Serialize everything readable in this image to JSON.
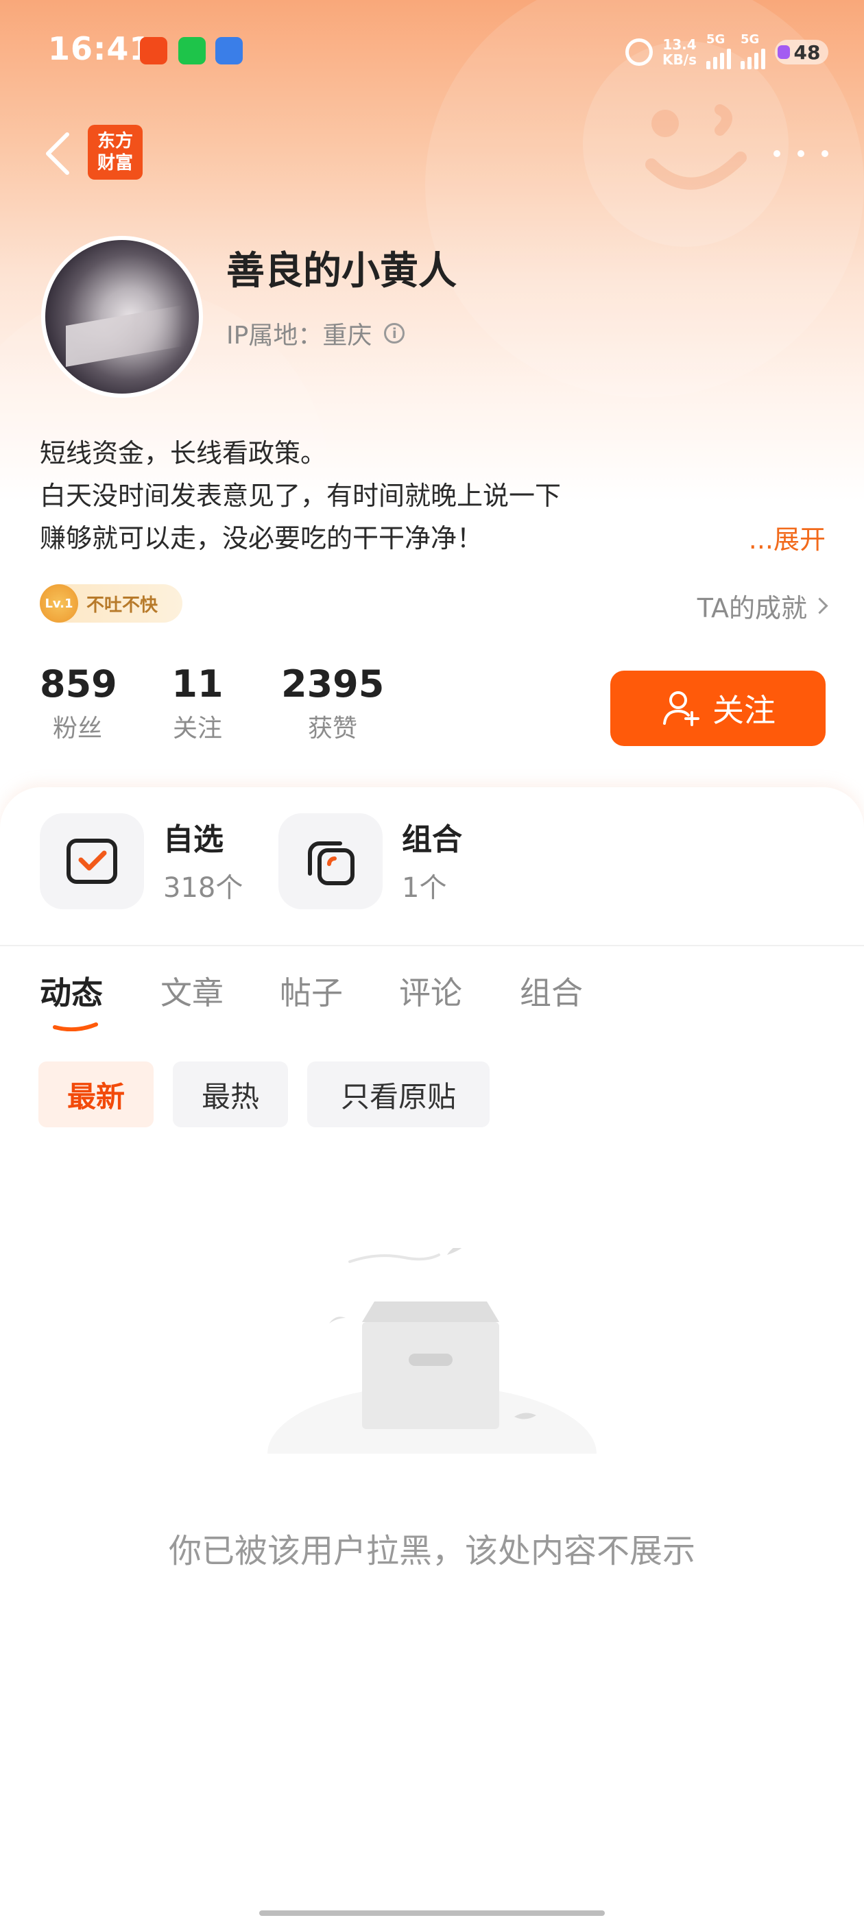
{
  "status_bar": {
    "time": "16:41",
    "net_speed_value": "13.4",
    "net_speed_unit": "KB/s",
    "signal1_label": "5G",
    "signal2_label": "5G",
    "battery": "48",
    "app_icons": [
      "toutiao-icon",
      "wechat-icon",
      "stock-app-icon"
    ]
  },
  "header": {
    "logo_line1": "东方",
    "logo_line2": "财富"
  },
  "profile": {
    "name": "善良的小黄人",
    "ip_label": "IP属地：重庆",
    "bio": [
      "短线资金，长线看政策。",
      "白天没时间发表意见了，有时间就晚上说一下",
      "赚够就可以走，没必要吃的干干净净！"
    ],
    "expand_label": "...展开",
    "badge_level": "Lv.1",
    "badge_text": "不吐不快",
    "achievements_label": "TA的成就"
  },
  "stats": [
    {
      "value": "859",
      "label": "粉丝"
    },
    {
      "value": "11",
      "label": "关注"
    },
    {
      "value": "2395",
      "label": "获赞"
    }
  ],
  "follow_button": "关注",
  "tiles": [
    {
      "title": "自选",
      "sub": "318个"
    },
    {
      "title": "组合",
      "sub": "1个"
    }
  ],
  "tabs": [
    "动态",
    "文章",
    "帖子",
    "评论",
    "组合"
  ],
  "active_tab": "动态",
  "filters": [
    "最新",
    "最热",
    "只看原贴"
  ],
  "active_filter": "最新",
  "empty_message": "你已被该用户拉黑，该处内容不展示",
  "colors": {
    "accent": "#ff5a0a",
    "accent_text": "#f26a1b",
    "logo_bg": "#f2511a"
  }
}
